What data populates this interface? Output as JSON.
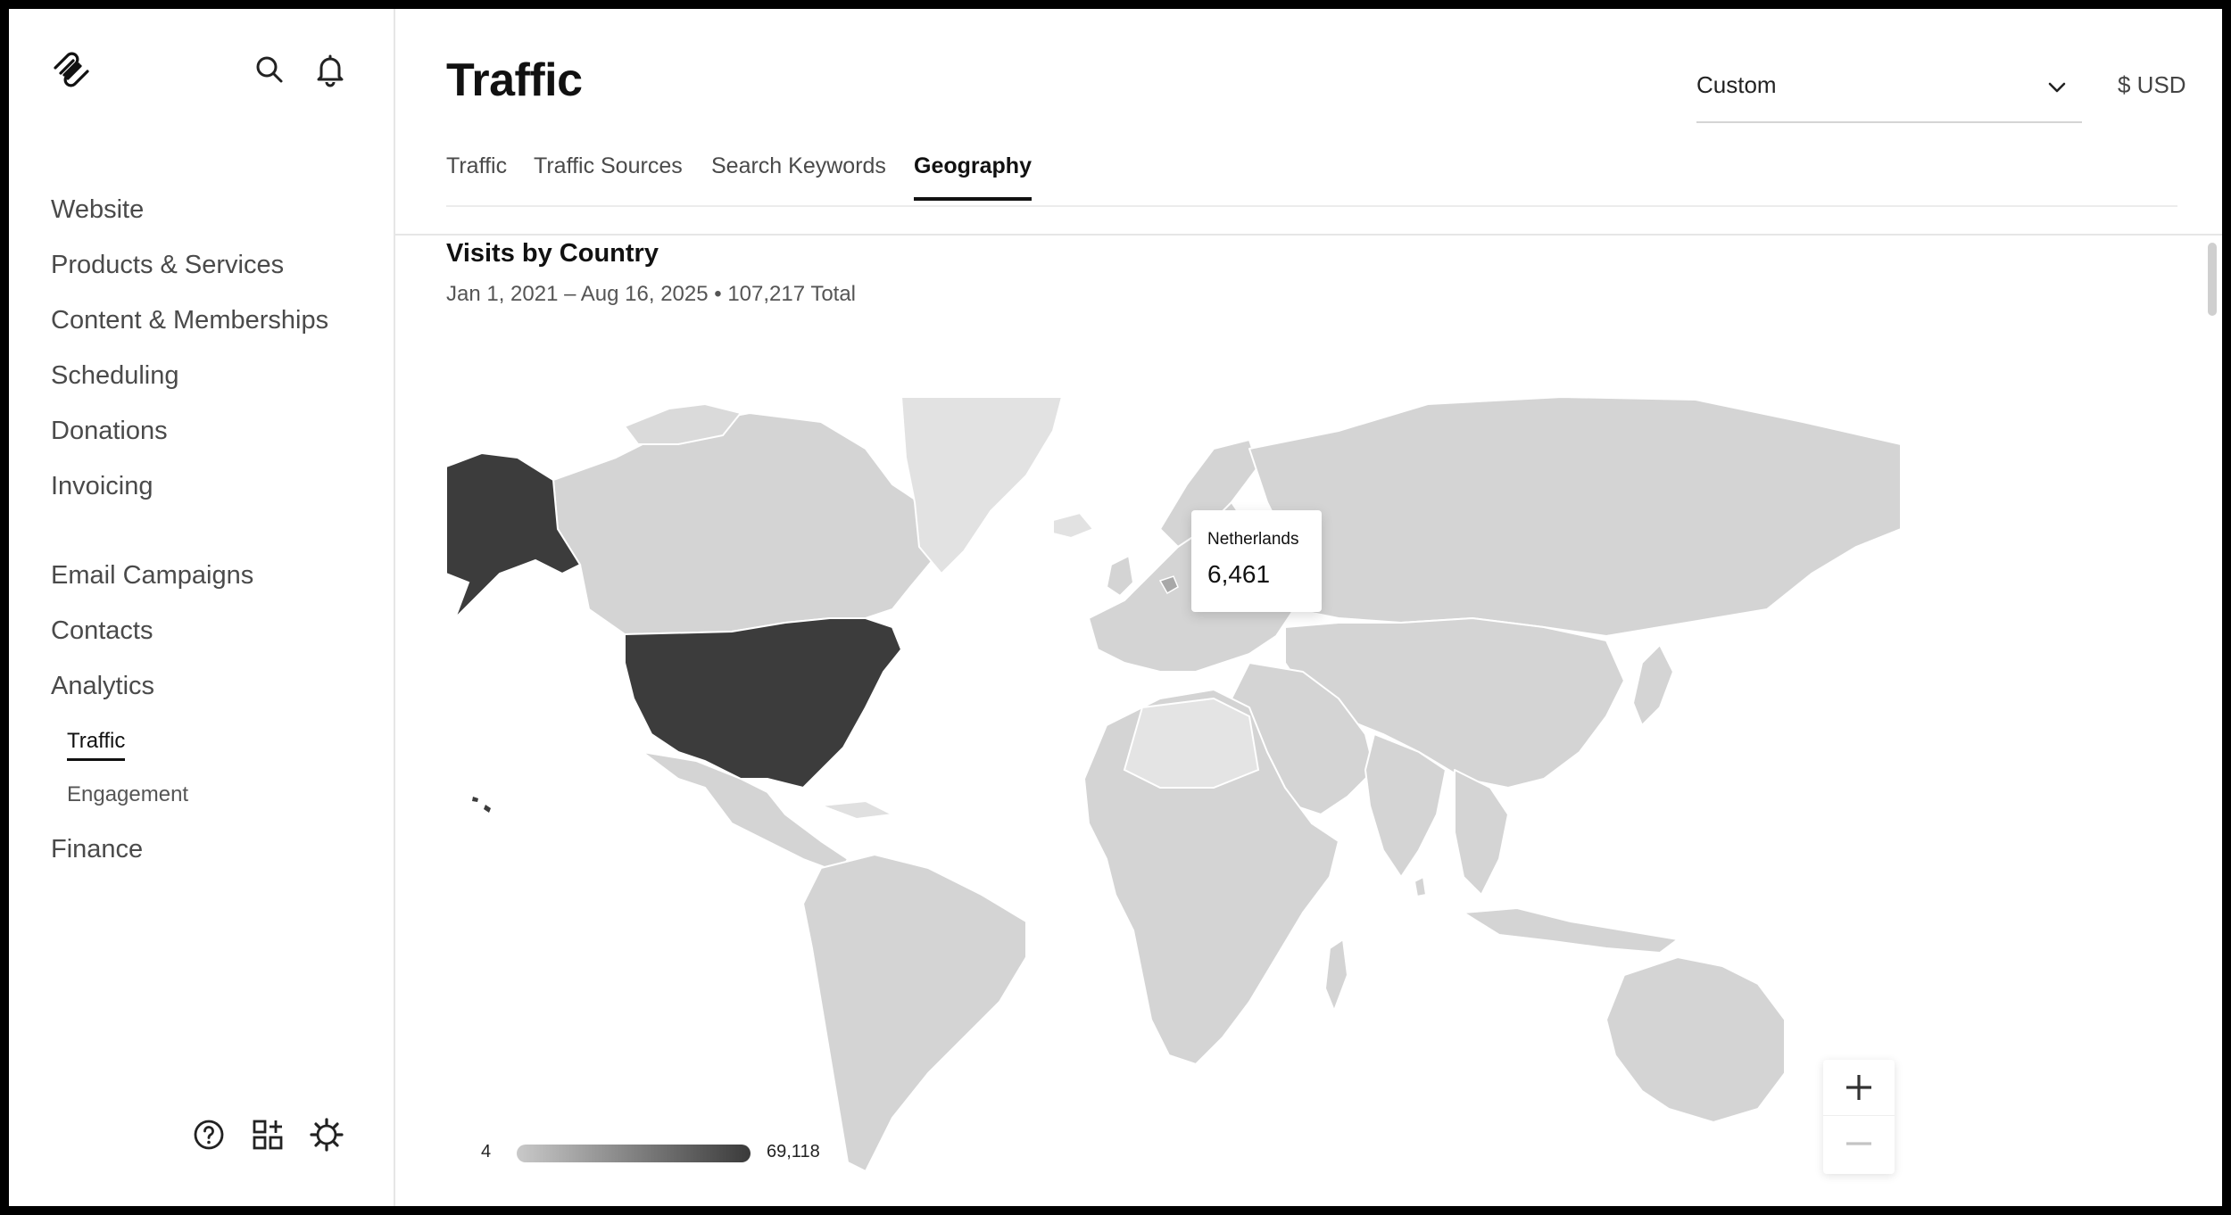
{
  "sidebar": {
    "nav": [
      "Website",
      "Products & Services",
      "Content & Memberships",
      "Scheduling",
      "Donations",
      "Invoicing",
      "Email Campaigns",
      "Contacts",
      "Analytics"
    ],
    "analytics_sub": [
      "Traffic",
      "Engagement"
    ],
    "finance": "Finance"
  },
  "header": {
    "title": "Traffic",
    "date_range_select": "Custom",
    "currency": "$ USD"
  },
  "tabs": [
    "Traffic",
    "Traffic Sources",
    "Search Keywords",
    "Geography"
  ],
  "active_tab": "Geography",
  "section": {
    "title": "Visits by Country",
    "subtitle": "Jan 1, 2021 – Aug 16, 2025 • 107,217 Total"
  },
  "map": {
    "tooltip": {
      "country": "Netherlands",
      "value": "6,461"
    },
    "legend": {
      "min": "4",
      "max": "69,118"
    },
    "colors": {
      "land_default": "#d4d4d4",
      "land_high": "#3c3c3c",
      "land_low": "#e4e4e4",
      "border": "#ffffff"
    }
  }
}
